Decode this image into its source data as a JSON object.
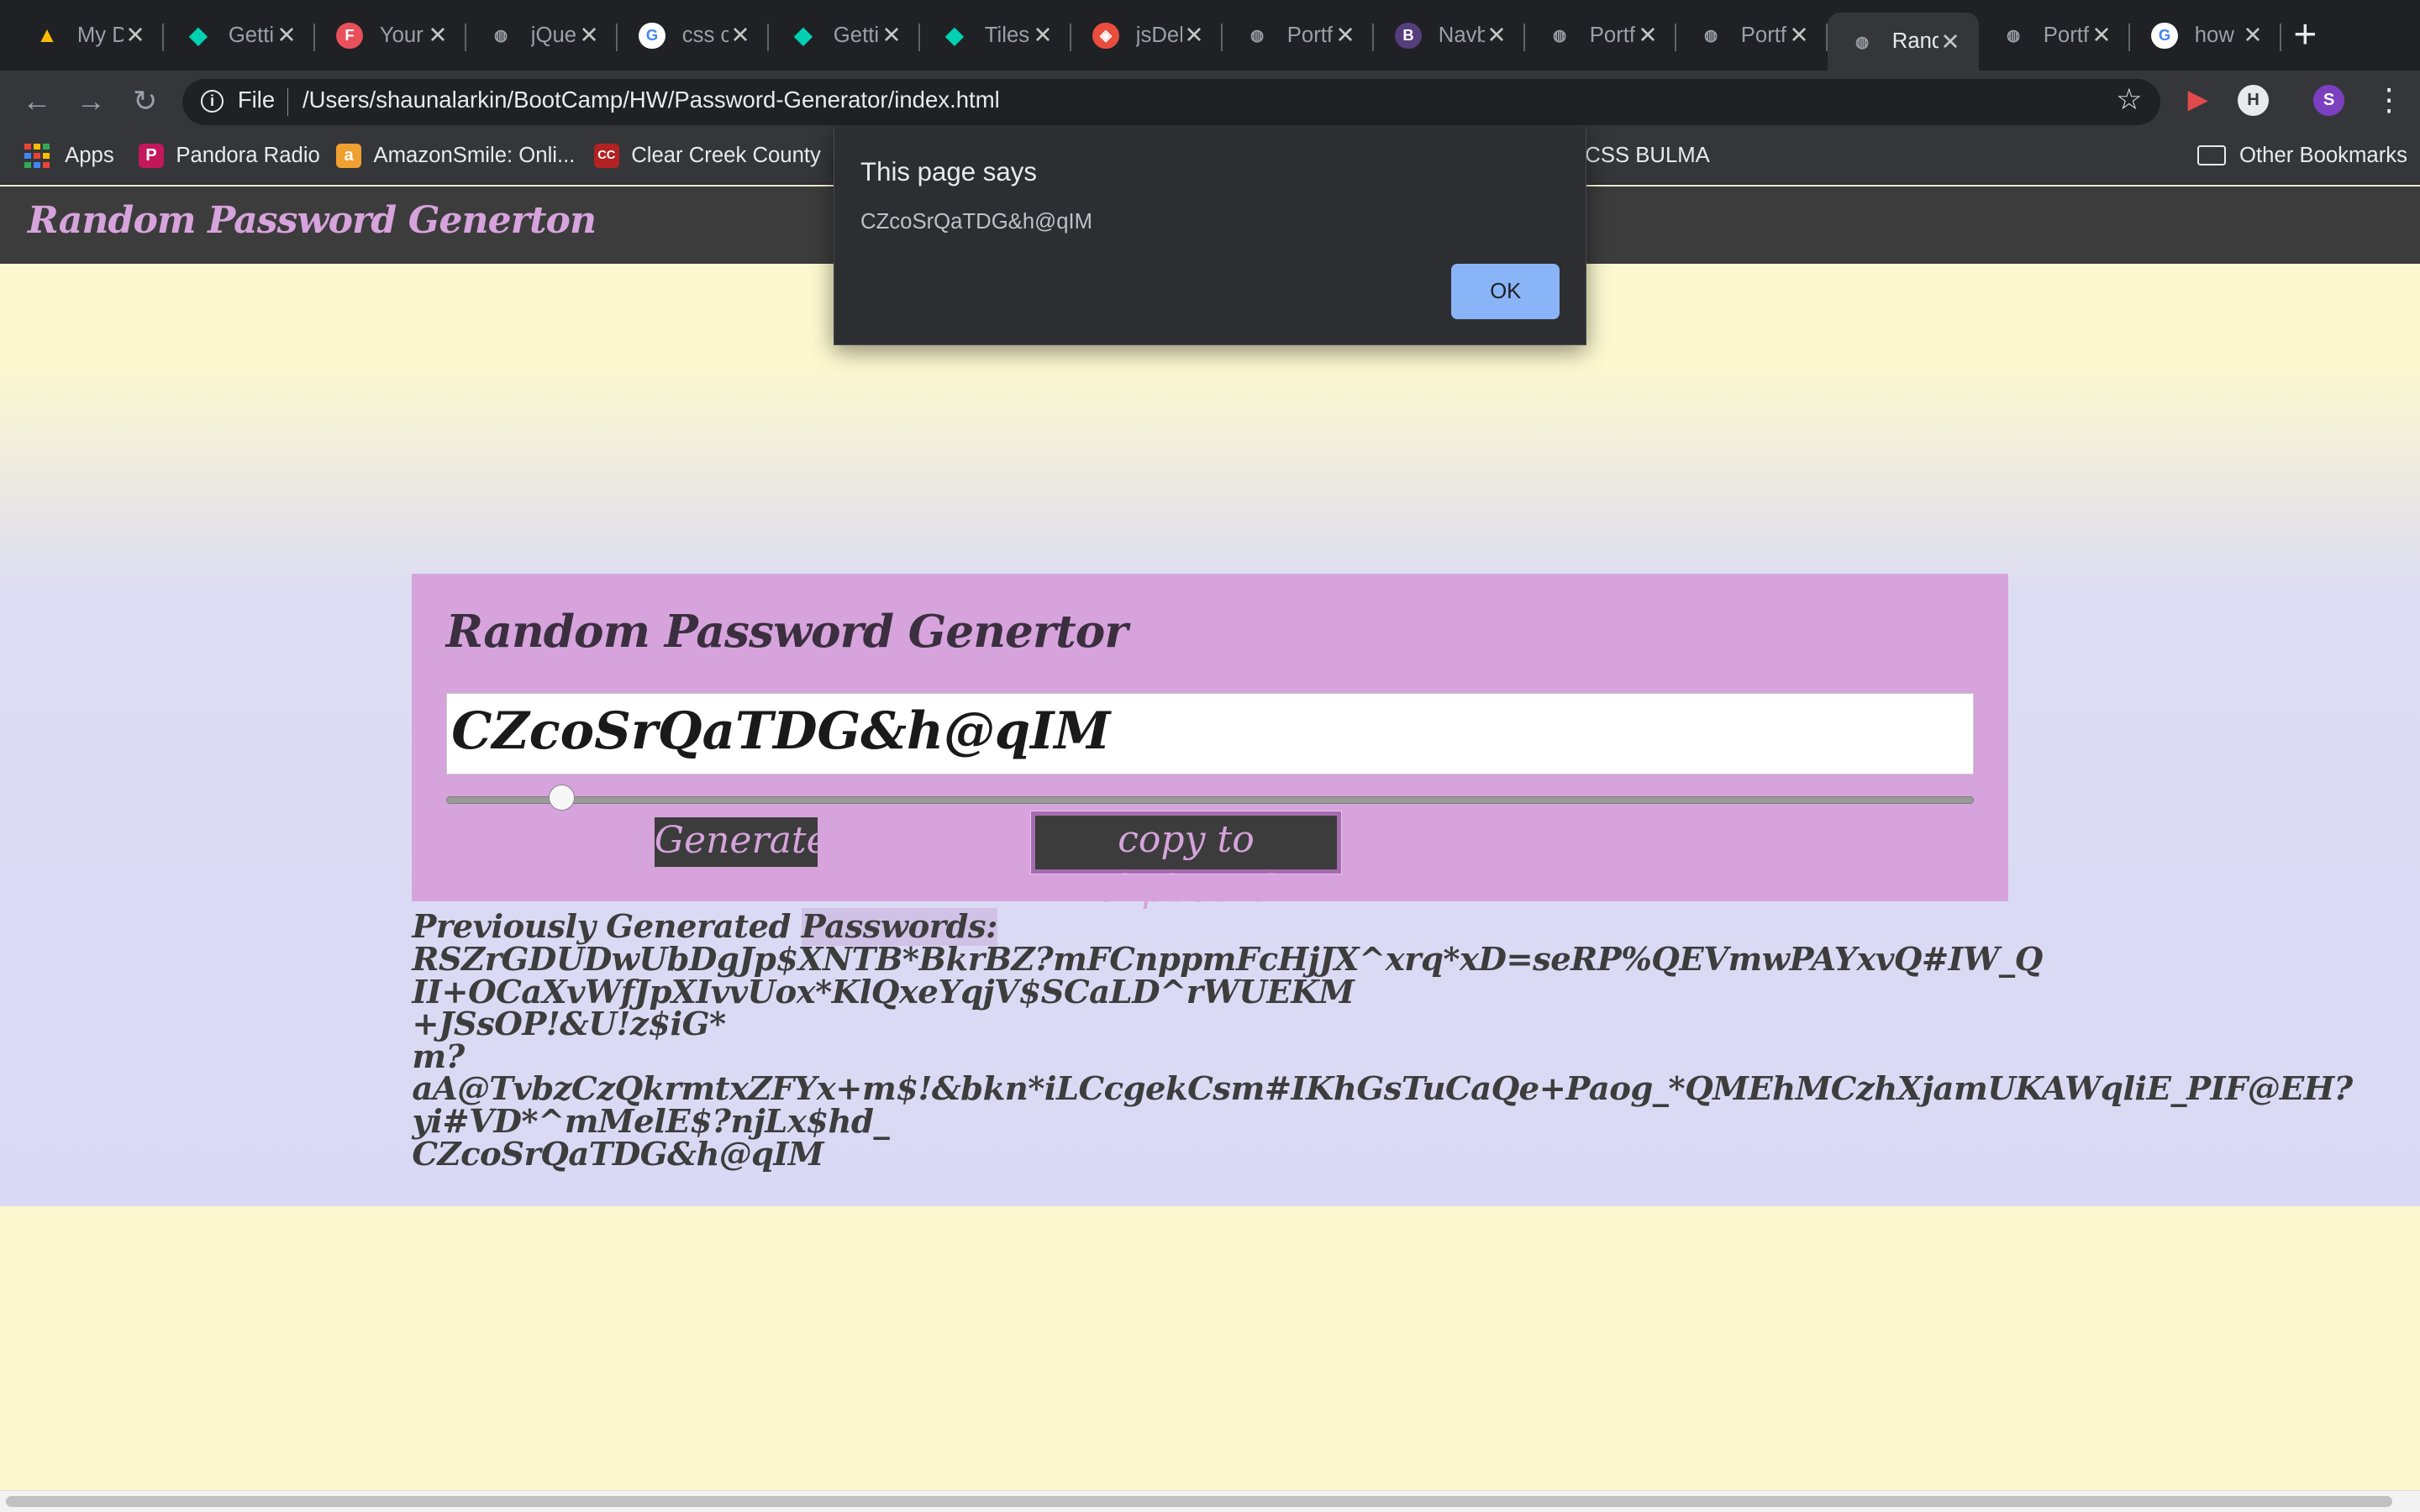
{
  "browser": {
    "tabs": [
      {
        "title": "My D",
        "favicon": "drive-icon",
        "color": "#fbbc04"
      },
      {
        "title": "Getti",
        "favicon": "bulma-icon",
        "color": "#00d1b2"
      },
      {
        "title": "Your",
        "favicon": "f-icon",
        "color": "#e8505b"
      },
      {
        "title": "jQue",
        "favicon": "globe-icon",
        "color": "#5f6368"
      },
      {
        "title": "css c",
        "favicon": "google-icon",
        "color": "#4285f4"
      },
      {
        "title": "Getti",
        "favicon": "bulma-icon",
        "color": "#00d1b2"
      },
      {
        "title": "Tiles",
        "favicon": "bulma-icon",
        "color": "#00d1b2"
      },
      {
        "title": "jsDel",
        "favicon": "jsdelivr-icon",
        "color": "#e84d3d"
      },
      {
        "title": "Portf",
        "favicon": "globe-icon",
        "color": "#5f6368"
      },
      {
        "title": "Navb",
        "favicon": "bootstrap-icon",
        "color": "#563d7c"
      },
      {
        "title": "Portf",
        "favicon": "globe-icon",
        "color": "#5f6368"
      },
      {
        "title": "Portf",
        "favicon": "globe-icon",
        "color": "#5f6368"
      },
      {
        "title": "Rand",
        "favicon": "globe-icon",
        "color": "#5f6368",
        "active": true
      },
      {
        "title": "Portf",
        "favicon": "globe-icon",
        "color": "#5f6368"
      },
      {
        "title": "how",
        "favicon": "google-icon",
        "color": "#4285f4"
      }
    ],
    "new_tab_glyph": "+",
    "address": {
      "scheme": "File",
      "url": "/Users/shaunalarkin/BootCamp/HW/Password-Generator/index.html"
    },
    "profile_initial": "S",
    "bookmarks": [
      {
        "label": "Apps",
        "icon": "apps-grid-icon"
      },
      {
        "label": "Pandora Radio",
        "icon": "pandora-icon",
        "color": "#c2185b"
      },
      {
        "label": "AmazonSmile: Onli...",
        "icon": "amazon-icon",
        "color": "#f0a030"
      },
      {
        "label": "Clear Creek County",
        "icon": "county-icon",
        "color": "#b22222"
      },
      {
        "label": "CSS BULMA",
        "icon": "bulma-icon"
      },
      {
        "label": "Other Bookmarks",
        "icon": "folder-icon"
      }
    ]
  },
  "page": {
    "navbar_brand": "Random Password Generton",
    "card_title": "Random Password Genertor",
    "password_value": "CZcoSrQaTDG&h@qIM",
    "length_slider_fraction": 0.075,
    "generate_label": "Generate",
    "copy_label": "copy to clipboard",
    "history_heading_a": "Previously Generated ",
    "history_heading_b": "Passwords:",
    "history_lines": [
      "RSZrGDUDwUbDgJp$XNTB*BkrBZ?mFCnppmFcHjJX^xrq*xD=seRP%QEVmwPAYxvQ#IW_Q",
      "II+OCaXvWfJpXIvvUox*KlQxeYqjV$SCaLD^rWUEKM",
      "+JSsOP!&U!z$iG*",
      "m?",
      "aA@TvbzCzQkrmtxZFYx+m$!&bkn*iLCcgekCsm#IKhGsTuCaQe+Paog_*QMEhMCzhXjamUKAWqliE_PIF@EH?",
      "yi#VD*^mMelE$?njLx$hd_",
      "CZcoSrQaTDG&h@qIM"
    ]
  },
  "dialog": {
    "title": "This page says",
    "message": "CZcoSrQaTDG&h@qIM",
    "ok_label": "OK"
  },
  "colors": {
    "accent_purple": "#d6a3dc",
    "navbar_dark": "#3c3c3c",
    "page_yellow": "#fcf8cf",
    "page_lavender": "#dad9f5",
    "dialog_ok_blue": "#8ab4f8"
  }
}
